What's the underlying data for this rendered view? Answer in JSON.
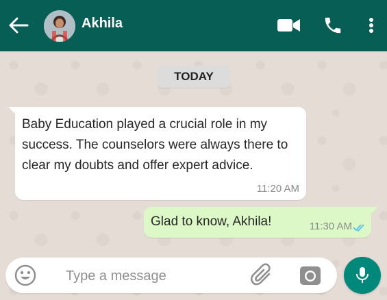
{
  "header": {
    "contact_name": "Akhila",
    "icons": [
      "back-arrow-icon",
      "avatar",
      "video-camera-icon",
      "phone-icon",
      "more-vertical-icon"
    ]
  },
  "chat": {
    "date_chip": "TODAY",
    "messages": [
      {
        "direction": "incoming",
        "text": "Baby Education played a crucial role in my success. The counselors were always there to clear my doubts and offer expert advice.",
        "time": "11:20 AM"
      },
      {
        "direction": "outgoing",
        "text": "Glad to know, Akhila!",
        "time": "11:30 AM",
        "status": "read"
      }
    ]
  },
  "composer": {
    "placeholder": "Type a message",
    "value": "",
    "icons": [
      "emoji-icon",
      "paperclip-icon",
      "camera-icon",
      "microphone-icon"
    ]
  },
  "colors": {
    "header": "#075e54",
    "chat_background": "#e5ddd5",
    "incoming_bubble": "#ffffff",
    "outgoing_bubble": "#dcf8c6",
    "mic_button": "#00897b",
    "read_ticks": "#4fc3f7"
  }
}
